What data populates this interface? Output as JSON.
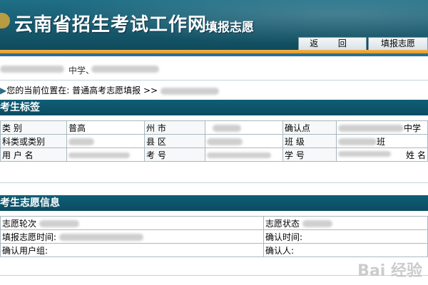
{
  "header": {
    "site_title": "云南省招生考试工作网",
    "sub_title": "填报志愿",
    "tabs": [
      {
        "label": "返 回"
      },
      {
        "label": "填报志愿"
      }
    ]
  },
  "user_bar": {
    "text": "中学、"
  },
  "breadcrumb": {
    "prefix": "您的当前位置在:",
    "path": "普通高考志愿填报",
    "sep": ">>"
  },
  "section1": {
    "title": "考生标签",
    "rows": [
      [
        {
          "label": "类  别"
        },
        {
          "value": "普高"
        },
        {
          "label": "州  市"
        },
        {
          "value": ""
        },
        {
          "label": "确认点"
        },
        {
          "value": "中学"
        }
      ],
      [
        {
          "label": "科类或类别"
        },
        {
          "value": ""
        },
        {
          "label": "县  区"
        },
        {
          "value": ""
        },
        {
          "label": "班  级"
        },
        {
          "value": "班"
        }
      ],
      [
        {
          "label": "用 户 名"
        },
        {
          "value": ""
        },
        {
          "label": "考  号"
        },
        {
          "value": ""
        },
        {
          "label": "学  号"
        },
        {
          "value": ""
        },
        {
          "label": "姓  名"
        }
      ]
    ]
  },
  "section2": {
    "title": "考生志愿信息",
    "rows": [
      [
        {
          "label": "志愿轮次"
        },
        {
          "label": "志愿状态"
        }
      ],
      [
        {
          "label": "填报志愿时间:"
        },
        {
          "label": "确认时间:"
        }
      ],
      [
        {
          "label": "确认用户组:"
        },
        {
          "label": "确认人:"
        }
      ]
    ]
  },
  "watermark": "Bai 经验"
}
